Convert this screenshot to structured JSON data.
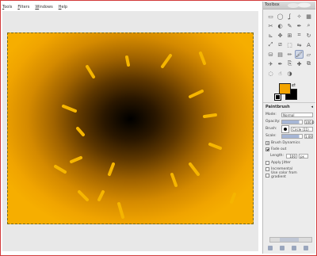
{
  "menu": [
    "Tools",
    "Filters",
    "Windows",
    "Help"
  ],
  "toolbox": {
    "title": "Toolbox",
    "tools": [
      {
        "name": "rect-select",
        "glyph": "▭"
      },
      {
        "name": "ellipse-select",
        "glyph": "◯"
      },
      {
        "name": "lasso",
        "glyph": "ʆ"
      },
      {
        "name": "fuzzy-select",
        "glyph": "✧"
      },
      {
        "name": "color-select",
        "glyph": "▦"
      },
      {
        "name": "scissors",
        "glyph": "✂"
      },
      {
        "name": "foreground-select",
        "glyph": "◐"
      },
      {
        "name": "paths",
        "glyph": "✎"
      },
      {
        "name": "color-picker",
        "glyph": "✒"
      },
      {
        "name": "zoom",
        "glyph": "⌕"
      },
      {
        "name": "measure",
        "glyph": "⊾"
      },
      {
        "name": "move",
        "glyph": "✥"
      },
      {
        "name": "align",
        "glyph": "⊞"
      },
      {
        "name": "crop",
        "glyph": "⌗"
      },
      {
        "name": "rotate",
        "glyph": "↻"
      },
      {
        "name": "scale",
        "glyph": "⤢"
      },
      {
        "name": "shear",
        "glyph": "⧄"
      },
      {
        "name": "perspective",
        "glyph": "⬚"
      },
      {
        "name": "flip",
        "glyph": "⇋"
      },
      {
        "name": "text",
        "glyph": "A"
      },
      {
        "name": "bucket-fill",
        "glyph": "⛁"
      },
      {
        "name": "blend",
        "glyph": "▤"
      },
      {
        "name": "pencil",
        "glyph": "✏"
      },
      {
        "name": "paintbrush",
        "glyph": "🖌",
        "active": true
      },
      {
        "name": "eraser",
        "glyph": "▱"
      },
      {
        "name": "airbrush",
        "glyph": "✈"
      },
      {
        "name": "ink",
        "glyph": "✒"
      },
      {
        "name": "clone",
        "glyph": "⎘"
      },
      {
        "name": "heal",
        "glyph": "✚"
      },
      {
        "name": "perspective-clone",
        "glyph": "⧉"
      },
      {
        "name": "blur",
        "glyph": "◌"
      },
      {
        "name": "smudge",
        "glyph": "☝"
      },
      {
        "name": "dodge-burn",
        "glyph": "◑"
      }
    ],
    "fg_color": "#f3a400",
    "bg_color": "#000000"
  },
  "options": {
    "title": "Paintbrush",
    "mode_label": "Mode:",
    "mode_value": "Normal",
    "opacity_label": "Opacity:",
    "opacity_value": "100.0",
    "brush_label": "Brush:",
    "brush_name": "Circle (11)",
    "scale_label": "Scale:",
    "scale_value": "1.00",
    "brush_dynamics": "Brush Dynamics",
    "fade_out": "Fade out",
    "length_label": "Length:",
    "length_value": "100",
    "length_unit": "px",
    "apply_jitter": "Apply Jitter",
    "incremental": "Incremental",
    "use_gradient": "Use color from gradient"
  }
}
